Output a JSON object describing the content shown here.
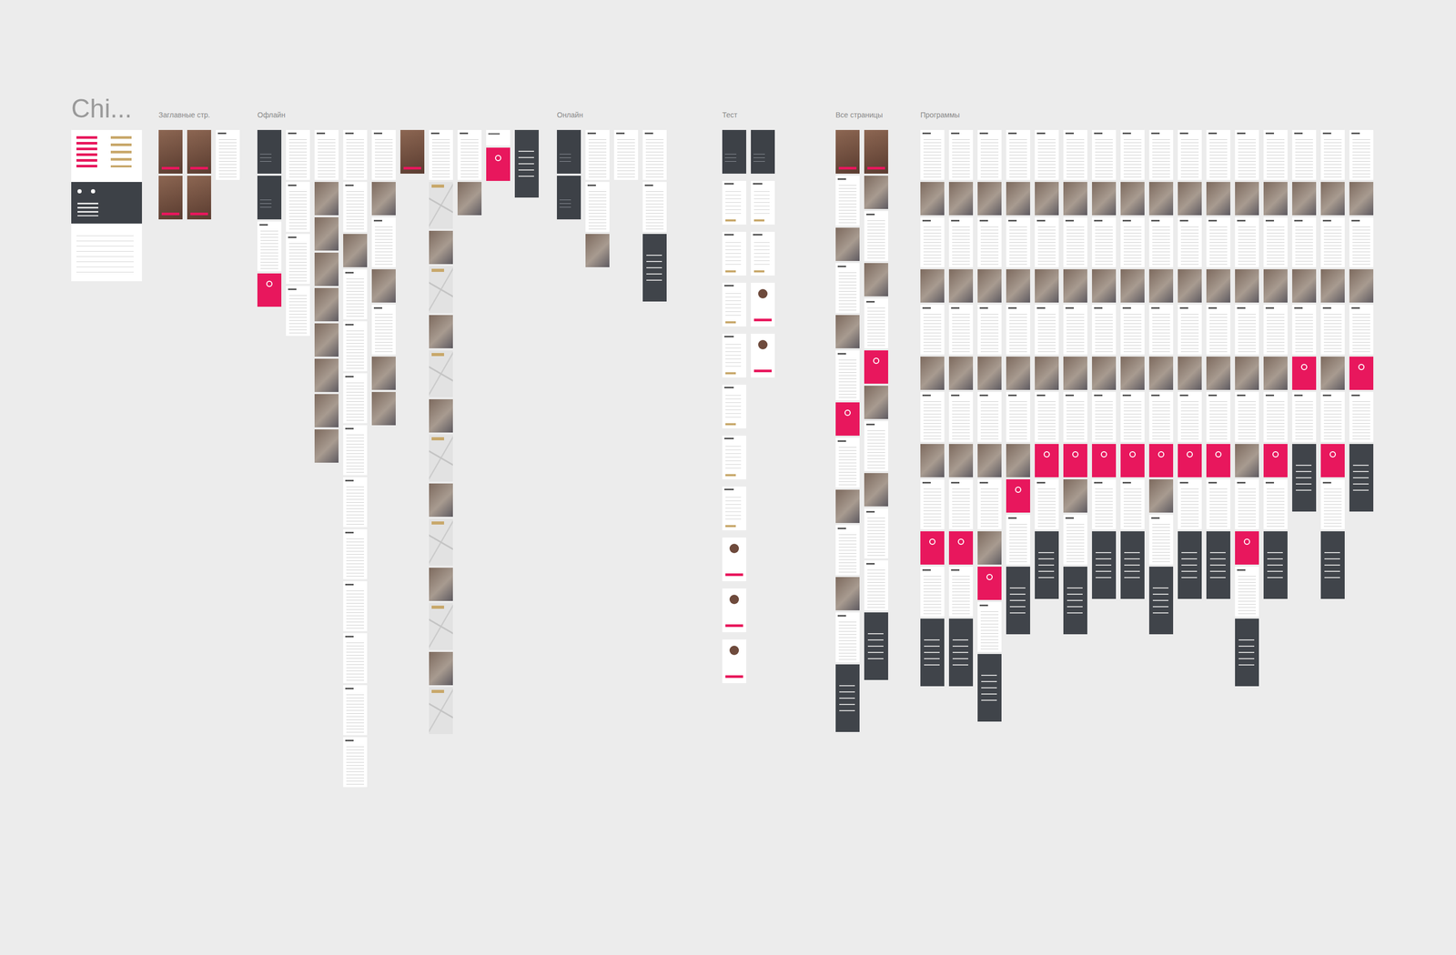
{
  "canvas": {
    "title": "Chi..."
  },
  "style_card": {
    "kinds": [
      "swatches",
      "darkpanel",
      "text"
    ]
  },
  "sections": [
    {
      "label": "Заглавные стр.",
      "columns": [
        [
          "hero",
          "hero"
        ],
        [
          "hero",
          "hero"
        ],
        [
          "text"
        ]
      ]
    },
    {
      "label": "Офлайн",
      "columns": [
        [
          "darkhero",
          "darkhero",
          "text",
          "pink"
        ],
        [
          "text",
          "text",
          "text",
          "text"
        ],
        [
          "text",
          "img",
          "img",
          "img",
          "img",
          "img",
          "img",
          "img",
          "img"
        ],
        [
          "text",
          "text",
          "img",
          "text",
          "text",
          "text",
          "text",
          "text",
          "text",
          "text",
          "text",
          "text",
          "text"
        ],
        [
          "text",
          "img",
          "text",
          "img",
          "text",
          "img",
          "img"
        ],
        [
          "hero"
        ],
        [
          "text",
          "map",
          "img",
          "map",
          "img",
          "map",
          "img",
          "map",
          "img",
          "map",
          "img",
          "map",
          "img",
          "map"
        ],
        [
          "text",
          "img"
        ],
        [
          "plain",
          "pink"
        ],
        [
          "footer"
        ]
      ]
    },
    {
      "label": "Онлайн",
      "columns": [
        [
          "darkhero",
          "darkhero"
        ],
        [
          "text",
          "text",
          "img"
        ],
        [
          "text"
        ],
        [
          "text",
          "text",
          "footer"
        ]
      ]
    },
    {
      "label": "Тест",
      "columns": [
        [
          "darkhero",
          "card",
          "card",
          "card",
          "card",
          "card",
          "card",
          "card",
          "avatar",
          "avatar",
          "avatar"
        ],
        [
          "darkhero",
          "card",
          "card",
          "avatar",
          "avatar"
        ]
      ]
    },
    {
      "label": "Все страницы",
      "columns": [
        [
          "hero",
          "text",
          "img",
          "text",
          "img",
          "text",
          "pink",
          "text",
          "img",
          "text",
          "img",
          "text",
          "footer"
        ],
        [
          "hero",
          "img",
          "text",
          "img",
          "text",
          "pink",
          "img",
          "text",
          "img",
          "text",
          "text",
          "footer"
        ]
      ]
    },
    {
      "label": "Программы",
      "columns": [
        [
          "text",
          "img",
          "text",
          "img",
          "text",
          "img",
          "text",
          "img",
          "text",
          "pink",
          "text",
          "footer"
        ],
        [
          "text",
          "img",
          "text",
          "img",
          "text",
          "img",
          "text",
          "img",
          "text",
          "pink",
          "text",
          "footer"
        ],
        [
          "text",
          "img",
          "text",
          "img",
          "text",
          "img",
          "text",
          "img",
          "text",
          "img",
          "pink",
          "text",
          "footer"
        ],
        [
          "text",
          "img",
          "text",
          "img",
          "text",
          "img",
          "text",
          "img",
          "pink",
          "text",
          "footer"
        ],
        [
          "text",
          "img",
          "text",
          "img",
          "text",
          "img",
          "text",
          "pink",
          "text",
          "footer"
        ],
        [
          "text",
          "img",
          "text",
          "img",
          "text",
          "img",
          "text",
          "pink",
          "img",
          "text",
          "footer"
        ],
        [
          "text",
          "img",
          "text",
          "img",
          "text",
          "img",
          "text",
          "pink",
          "text",
          "footer"
        ],
        [
          "text",
          "img",
          "text",
          "img",
          "text",
          "img",
          "text",
          "pink",
          "text",
          "footer"
        ],
        [
          "text",
          "img",
          "text",
          "img",
          "text",
          "img",
          "text",
          "pink",
          "img",
          "text",
          "footer"
        ],
        [
          "text",
          "img",
          "text",
          "img",
          "text",
          "img",
          "text",
          "pink",
          "text",
          "footer"
        ],
        [
          "text",
          "img",
          "text",
          "img",
          "text",
          "img",
          "text",
          "pink",
          "text",
          "footer"
        ],
        [
          "text",
          "img",
          "text",
          "img",
          "text",
          "img",
          "text",
          "img",
          "text",
          "pink",
          "text",
          "footer"
        ],
        [
          "text",
          "img",
          "text",
          "img",
          "text",
          "img",
          "text",
          "pink",
          "text",
          "footer"
        ],
        [
          "text",
          "img",
          "text",
          "img",
          "text",
          "pink",
          "text",
          "footer"
        ],
        [
          "text",
          "img",
          "text",
          "img",
          "text",
          "img",
          "text",
          "pink",
          "text",
          "footer"
        ],
        [
          "text",
          "img",
          "text",
          "img",
          "text",
          "pink",
          "text",
          "footer"
        ]
      ]
    }
  ]
}
